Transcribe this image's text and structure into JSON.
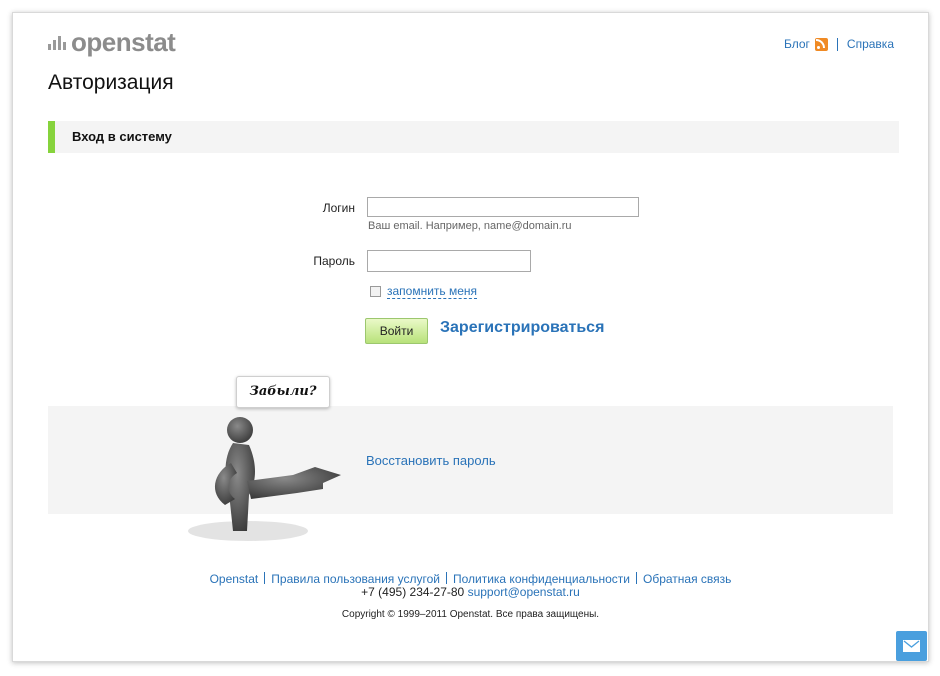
{
  "header": {
    "logo_text": "openstat",
    "blog_label": "Блог",
    "help_label": "Справка",
    "rss_icon": "rss-icon"
  },
  "page_title": "Авторизация",
  "section_title": "Вход в систему",
  "form": {
    "login_label": "Логин",
    "login_value": "",
    "login_hint": "Ваш email. Например, name@domain.ru",
    "password_label": "Пароль",
    "password_value": "",
    "remember_label": "запомнить меня",
    "remember_checked": false,
    "submit_label": "Войти",
    "register_label": "Зарегистрироваться"
  },
  "restore": {
    "bubble_text": "Забыли?",
    "link_label": "Восстановить пароль"
  },
  "footer": {
    "links": [
      "Openstat",
      "Правила пользования услугой",
      "Политика конфиденциальности",
      "Обратная связь"
    ],
    "phone": "+7 (495) 234-27-80",
    "email": "support@openstat.ru",
    "copyright": "Copyright © 1999–2011 Openstat. Все права защищены."
  },
  "colors": {
    "accent_green": "#86d33c",
    "link_blue": "#2a73b8",
    "mail_button": "#4a9fde"
  }
}
